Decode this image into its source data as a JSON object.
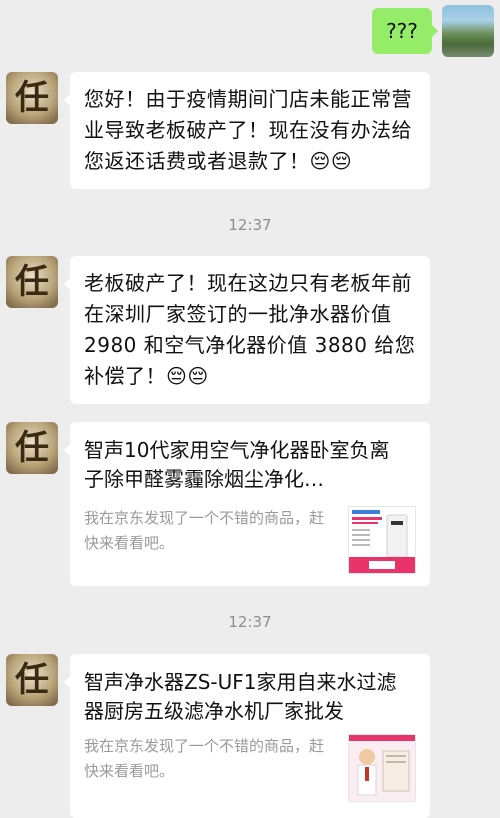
{
  "messages": {
    "me_text": "???",
    "msg1_text": "您好！由于疫情期间门店未能正常营业导致老板破产了！现在没有办法给您返还话费或者退款了！😔😔",
    "time1": "12:37",
    "msg2_text": "老板破产了！现在这边只有老板年前在深圳厂家签订的一批净水器价值 2980 和空气净化器价值 3880 给您补偿了！😔😔",
    "card1": {
      "title": "智声10代家用空气净化器卧室负离子除甲醛雾霾除烟尘净化…",
      "desc": "我在京东发现了一个不错的商品，赶快来看看吧。"
    },
    "time2": "12:37",
    "card2": {
      "title": "智声净水器ZS-UF1家用自来水过滤器厨房五级滤净水机厂家批发",
      "desc": "我在京东发现了一个不错的商品，赶快来看看吧。"
    }
  },
  "avatar_glyph": "任",
  "colors": {
    "background": "#ededed",
    "my_bubble": "#95ec69",
    "their_bubble": "#ffffff",
    "time_text": "#8e8e8e",
    "desc_text": "#9a9a9a",
    "accent_pink": "#e8336b"
  }
}
